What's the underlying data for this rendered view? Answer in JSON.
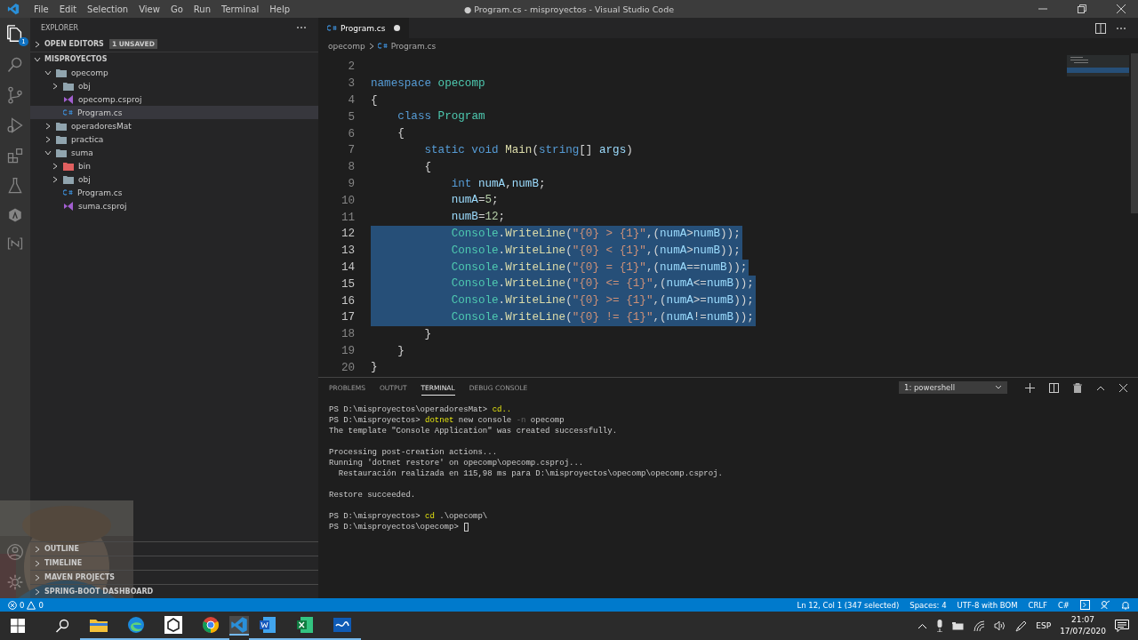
{
  "window": {
    "title": "● Program.cs - misproyectos - Visual Studio Code"
  },
  "menu": [
    "File",
    "Edit",
    "Selection",
    "View",
    "Go",
    "Run",
    "Terminal",
    "Help"
  ],
  "activity_bar": {
    "explorer_badge": "1"
  },
  "sidebar": {
    "title": "EXPLORER",
    "open_editors": {
      "label": "OPEN EDITORS",
      "badge": "1 UNSAVED",
      "expanded": false
    },
    "tree": {
      "label": "MISPROYECTOS",
      "expanded": true,
      "children": [
        {
          "label": "opecomp",
          "kind": "folder",
          "expanded": true,
          "selected": false,
          "children": [
            {
              "label": "obj",
              "kind": "folder",
              "expanded": false,
              "selected": false
            },
            {
              "label": "opecomp.csproj",
              "kind": "csproj",
              "selected": false
            },
            {
              "label": "Program.cs",
              "kind": "cs",
              "selected": true
            }
          ]
        },
        {
          "label": "operadoresMat",
          "kind": "folder",
          "expanded": false,
          "selected": false
        },
        {
          "label": "practica",
          "kind": "folder",
          "expanded": false,
          "selected": false
        },
        {
          "label": "suma",
          "kind": "folder",
          "expanded": true,
          "selected": false,
          "children": [
            {
              "label": "bin",
              "kind": "bin_folder",
              "expanded": false,
              "selected": false
            },
            {
              "label": "obj",
              "kind": "folder",
              "expanded": false,
              "selected": false
            },
            {
              "label": "Program.cs",
              "kind": "cs",
              "selected": false
            },
            {
              "label": "suma.csproj",
              "kind": "csproj",
              "selected": false
            }
          ]
        }
      ]
    },
    "bottom_sections": [
      {
        "label": "OUTLINE",
        "expanded": false
      },
      {
        "label": "TIMELINE",
        "expanded": false
      },
      {
        "label": "MAVEN PROJECTS",
        "expanded": false
      },
      {
        "label": "SPRING-BOOT DASHBOARD",
        "expanded": false
      }
    ]
  },
  "tabs": [
    {
      "label": "Program.cs",
      "selected": true,
      "dirty": true
    }
  ],
  "breadcrumb": [
    {
      "label": "opecomp",
      "kind": "folder"
    },
    {
      "label": "Program.cs",
      "kind": "cs"
    }
  ],
  "code_lines": [
    {
      "number": "2",
      "selected": false
    },
    {
      "number": "3",
      "selected": false,
      "tokens": [
        {
          "text": "namespace",
          "kind": "keyword"
        },
        {
          "text": " opecomp",
          "kind": "type"
        }
      ]
    },
    {
      "number": "4",
      "selected": false,
      "tokens": [
        {
          "text": "{",
          "kind": "plain"
        }
      ]
    },
    {
      "number": "5",
      "selected": false,
      "tokens": [
        {
          "text": "    class",
          "kind": "keyword"
        },
        {
          "text": " Program",
          "kind": "type"
        }
      ]
    },
    {
      "number": "6",
      "selected": false,
      "tokens": [
        {
          "text": "    {",
          "kind": "plain"
        }
      ]
    },
    {
      "number": "7",
      "selected": false,
      "tokens": [
        {
          "text": "        static void",
          "kind": "keyword"
        },
        {
          "text": " Main",
          "kind": "method"
        },
        {
          "text": "(",
          "kind": "plain"
        },
        {
          "text": "string",
          "kind": "keyword"
        },
        {
          "text": "[] ",
          "kind": "plain"
        },
        {
          "text": "args",
          "kind": "variable"
        },
        {
          "text": ")",
          "kind": "plain"
        }
      ]
    },
    {
      "number": "8",
      "selected": false,
      "tokens": [
        {
          "text": "        {",
          "kind": "plain"
        }
      ]
    },
    {
      "number": "9",
      "selected": false,
      "tokens": [
        {
          "text": "            int",
          "kind": "keyword"
        },
        {
          "text": " numA",
          "kind": "variable"
        },
        {
          "text": ",",
          "kind": "plain"
        },
        {
          "text": "numB",
          "kind": "variable"
        },
        {
          "text": ";",
          "kind": "plain"
        }
      ]
    },
    {
      "number": "10",
      "selected": false,
      "tokens": [
        {
          "text": "            numA",
          "kind": "variable"
        },
        {
          "text": "=",
          "kind": "plain"
        },
        {
          "text": "5",
          "kind": "number"
        },
        {
          "text": ";",
          "kind": "plain"
        }
      ]
    },
    {
      "number": "11",
      "selected": false,
      "tokens": [
        {
          "text": "            numB",
          "kind": "variable"
        },
        {
          "text": "=",
          "kind": "plain"
        },
        {
          "text": "12",
          "kind": "number"
        },
        {
          "text": ";",
          "kind": "plain"
        }
      ]
    },
    {
      "number": "12",
      "selected": true,
      "tokens": [
        {
          "text": "            Console",
          "kind": "type"
        },
        {
          "text": ".",
          "kind": "plain"
        },
        {
          "text": "WriteLine",
          "kind": "method"
        },
        {
          "text": "(",
          "kind": "plain"
        },
        {
          "text": "\"{0} > {1}\"",
          "kind": "string"
        },
        {
          "text": ",(",
          "kind": "plain"
        },
        {
          "text": "numA",
          "kind": "variable"
        },
        {
          "text": ">",
          "kind": "plain"
        },
        {
          "text": "numB",
          "kind": "variable"
        },
        {
          "text": "));",
          "kind": "plain"
        }
      ]
    },
    {
      "number": "13",
      "selected": true,
      "tokens": [
        {
          "text": "            Console",
          "kind": "type"
        },
        {
          "text": ".",
          "kind": "plain"
        },
        {
          "text": "WriteLine",
          "kind": "method"
        },
        {
          "text": "(",
          "kind": "plain"
        },
        {
          "text": "\"{0} < {1}\"",
          "kind": "string"
        },
        {
          "text": ",(",
          "kind": "plain"
        },
        {
          "text": "numA",
          "kind": "variable"
        },
        {
          "text": ">",
          "kind": "plain"
        },
        {
          "text": "numB",
          "kind": "variable"
        },
        {
          "text": "));",
          "kind": "plain"
        }
      ]
    },
    {
      "number": "14",
      "selected": true,
      "tokens": [
        {
          "text": "            Console",
          "kind": "type"
        },
        {
          "text": ".",
          "kind": "plain"
        },
        {
          "text": "WriteLine",
          "kind": "method"
        },
        {
          "text": "(",
          "kind": "plain"
        },
        {
          "text": "\"{0} = {1}\"",
          "kind": "string"
        },
        {
          "text": ",(",
          "kind": "plain"
        },
        {
          "text": "numA",
          "kind": "variable"
        },
        {
          "text": "==",
          "kind": "plain"
        },
        {
          "text": "numB",
          "kind": "variable"
        },
        {
          "text": "));",
          "kind": "plain"
        }
      ]
    },
    {
      "number": "15",
      "selected": true,
      "tokens": [
        {
          "text": "            Console",
          "kind": "type"
        },
        {
          "text": ".",
          "kind": "plain"
        },
        {
          "text": "WriteLine",
          "kind": "method"
        },
        {
          "text": "(",
          "kind": "plain"
        },
        {
          "text": "\"{0} <= {1}\"",
          "kind": "string"
        },
        {
          "text": ",(",
          "kind": "plain"
        },
        {
          "text": "numA",
          "kind": "variable"
        },
        {
          "text": "<=",
          "kind": "plain"
        },
        {
          "text": "numB",
          "kind": "variable"
        },
        {
          "text": "));",
          "kind": "plain"
        }
      ]
    },
    {
      "number": "16",
      "selected": true,
      "tokens": [
        {
          "text": "            Console",
          "kind": "type"
        },
        {
          "text": ".",
          "kind": "plain"
        },
        {
          "text": "WriteLine",
          "kind": "method"
        },
        {
          "text": "(",
          "kind": "plain"
        },
        {
          "text": "\"{0} >= {1}\"",
          "kind": "string"
        },
        {
          "text": ",(",
          "kind": "plain"
        },
        {
          "text": "numA",
          "kind": "variable"
        },
        {
          "text": ">=",
          "kind": "plain"
        },
        {
          "text": "numB",
          "kind": "variable"
        },
        {
          "text": "));",
          "kind": "plain"
        }
      ]
    },
    {
      "number": "17",
      "selected": true,
      "tokens": [
        {
          "text": "            Console",
          "kind": "type"
        },
        {
          "text": ".",
          "kind": "plain"
        },
        {
          "text": "WriteLine",
          "kind": "method"
        },
        {
          "text": "(",
          "kind": "plain"
        },
        {
          "text": "\"{0} != {1}\"",
          "kind": "string"
        },
        {
          "text": ",(",
          "kind": "plain"
        },
        {
          "text": "numA",
          "kind": "variable"
        },
        {
          "text": "!=",
          "kind": "plain"
        },
        {
          "text": "numB",
          "kind": "variable"
        },
        {
          "text": "));",
          "kind": "plain"
        }
      ]
    },
    {
      "number": "18",
      "selected": false,
      "tokens": [
        {
          "text": "        }",
          "kind": "plain"
        }
      ]
    },
    {
      "number": "19",
      "selected": false,
      "tokens": [
        {
          "text": "    }",
          "kind": "plain"
        }
      ]
    },
    {
      "number": "20",
      "selected": false,
      "tokens": [
        {
          "text": "}",
          "kind": "plain"
        }
      ]
    }
  ],
  "panel": {
    "tabs": [
      {
        "label": "PROBLEMS",
        "selected": false
      },
      {
        "label": "OUTPUT",
        "selected": false
      },
      {
        "label": "TERMINAL",
        "selected": true
      },
      {
        "label": "DEBUG CONSOLE",
        "selected": false
      }
    ],
    "terminal_select": "1: powershell",
    "terminal_lines": [
      {
        "gap_before": false,
        "cursor": false,
        "segments": [
          {
            "text": "PS D:\\misproyectos\\operadoresMat> ",
            "kind": "plain"
          },
          {
            "text": "cd..",
            "kind": "command"
          }
        ]
      },
      {
        "gap_before": false,
        "cursor": false,
        "segments": [
          {
            "text": "PS D:\\misproyectos> ",
            "kind": "plain"
          },
          {
            "text": "dotnet",
            "kind": "command"
          },
          {
            "text": " new console ",
            "kind": "plain"
          },
          {
            "text": "-n",
            "kind": "flag"
          },
          {
            "text": " opecomp",
            "kind": "plain"
          }
        ]
      },
      {
        "gap_before": false,
        "cursor": false,
        "segments": [
          {
            "text": "The template \"Console Application\" was created successfully.",
            "kind": "plain"
          }
        ]
      },
      {
        "gap_before": true,
        "cursor": false,
        "segments": [
          {
            "text": "Processing post-creation actions...",
            "kind": "plain"
          }
        ]
      },
      {
        "gap_before": false,
        "cursor": false,
        "segments": [
          {
            "text": "Running 'dotnet restore' on opecomp\\opecomp.csproj...",
            "kind": "plain"
          }
        ]
      },
      {
        "gap_before": false,
        "cursor": false,
        "segments": [
          {
            "text": "  Restauración realizada en 115,98 ms para D:\\misproyectos\\opecomp\\opecomp.csproj.",
            "kind": "plain"
          }
        ]
      },
      {
        "gap_before": true,
        "cursor": false,
        "segments": [
          {
            "text": "Restore succeeded.",
            "kind": "plain"
          }
        ]
      },
      {
        "gap_before": true,
        "cursor": false,
        "segments": [
          {
            "text": "PS D:\\misproyectos> ",
            "kind": "plain"
          },
          {
            "text": "cd",
            "kind": "command"
          },
          {
            "text": " .\\opecomp\\",
            "kind": "plain"
          }
        ]
      },
      {
        "gap_before": false,
        "cursor": true,
        "segments": [
          {
            "text": "PS D:\\misproyectos\\opecomp> ",
            "kind": "plain"
          }
        ]
      }
    ]
  },
  "status_bar": {
    "errors": "0",
    "warnings": "0",
    "items": [
      "Ln 12, Col 1 (347 selected)",
      "Spaces: 4",
      "UTF-8 with BOM",
      "CRLF",
      "C#"
    ]
  },
  "taskbar": {
    "apps": [
      {
        "kind": "files",
        "active": false
      },
      {
        "kind": "edge",
        "active": false
      },
      {
        "kind": "unity",
        "active": false
      },
      {
        "kind": "chrome",
        "active": false
      },
      {
        "kind": "vscode",
        "active": true
      },
      {
        "kind": "word",
        "active": false
      },
      {
        "kind": "excel",
        "active": false
      },
      {
        "kind": "terminal",
        "active": false
      }
    ],
    "language": "ESP",
    "time": "21:07",
    "date": "17/07/2020"
  }
}
